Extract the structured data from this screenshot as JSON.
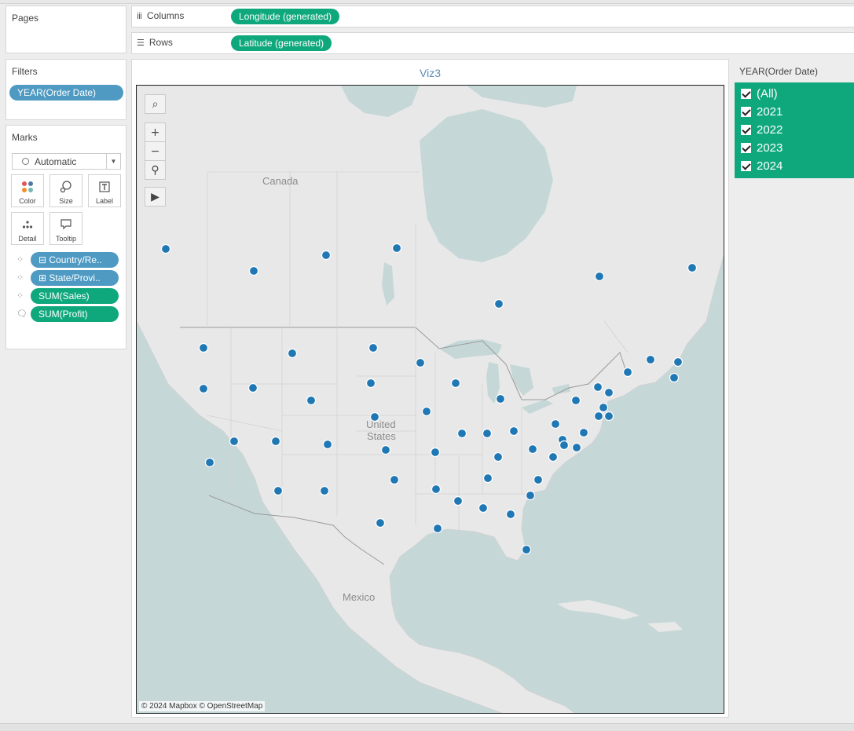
{
  "pages": {
    "title": "Pages"
  },
  "columns": {
    "label": "Columns",
    "pill": "Longitude (generated)"
  },
  "rows": {
    "label": "Rows",
    "pill": "Latitude (generated)"
  },
  "filters": {
    "title": "Filters",
    "pill": "YEAR(Order Date)"
  },
  "marks": {
    "title": "Marks",
    "type": "Automatic",
    "buttons": [
      "Color",
      "Size",
      "Label",
      "Detail",
      "Tooltip"
    ],
    "fields": [
      {
        "label": "Country/Re..",
        "kind": "detail",
        "color": "#4e9ac3"
      },
      {
        "label": "State/Provi..",
        "kind": "detail",
        "color": "#4e9ac3"
      },
      {
        "label": "SUM(Sales)",
        "kind": "detail",
        "color": "#0fa87d"
      },
      {
        "label": "SUM(Profit)",
        "kind": "tooltip",
        "color": "#0fa87d"
      }
    ]
  },
  "viz": {
    "title": "Viz3",
    "labels": {
      "canada": "Canada",
      "us_line1": "United",
      "us_line2": "States",
      "mexico": "Mexico"
    },
    "attribution": "© 2024 Mapbox © OpenStreetMap"
  },
  "legend": {
    "title": "YEAR(Order Date)",
    "items": [
      "(All)",
      "2021",
      "2022",
      "2023",
      "2024"
    ]
  },
  "colors": {
    "accent_green": "#0fa87d",
    "pill_blue": "#4e9ac3",
    "mark_blue": "#1f77b4",
    "title_blue": "#5b8db8"
  }
}
